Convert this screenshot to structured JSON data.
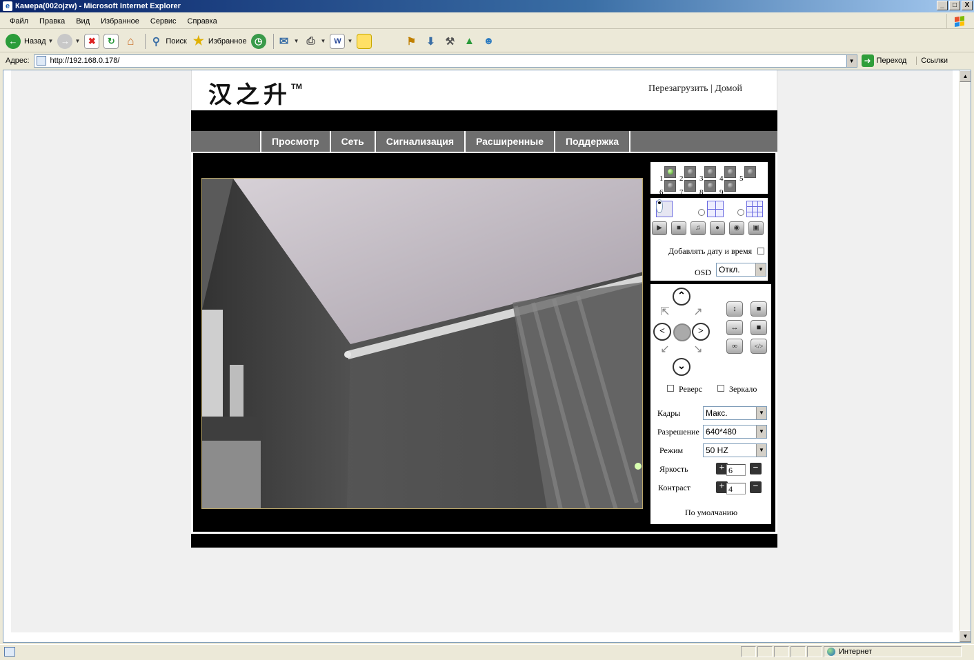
{
  "window": {
    "title": "Камера(002ojzw) - Microsoft Internet Explorer",
    "controls": [
      "_",
      "□",
      "X"
    ]
  },
  "menu": [
    "Файл",
    "Правка",
    "Вид",
    "Избранное",
    "Сервис",
    "Справка"
  ],
  "toolbar": {
    "back": "Назад",
    "search": "Поиск",
    "favorites": "Избранное"
  },
  "address": {
    "label": "Адрес:",
    "url": "http://192.168.0.178/",
    "go": "Переход",
    "links": "Ссылки"
  },
  "site": {
    "logo": "汉之升",
    "tm": "TM",
    "top_links": "Перезагрузить | Домой",
    "nav": [
      "Просмотр",
      "Сеть",
      "Сигнализация",
      "Расширенные",
      "Поддержка"
    ]
  },
  "cameras": [
    "1",
    "2",
    "3",
    "4",
    "5",
    "6",
    "7",
    "8",
    "9"
  ],
  "panel": {
    "add_datetime": "Добавлять дату и время",
    "osd_label": "OSD",
    "osd_value": "Откл.",
    "reverse": "Реверс",
    "mirror": "Зеркало",
    "frames_label": "Кадры",
    "frames_value": "Макс.",
    "resolution_label": "Разрешение",
    "resolution_value": "640*480",
    "mode_label": "Режим",
    "mode_value": "50 HZ",
    "brightness_label": "Яркость",
    "brightness_value": "6",
    "contrast_label": "Контраст",
    "contrast_value": "4",
    "default": "По умолчанию"
  },
  "status": {
    "zone": "Интернет"
  },
  "colors": {
    "ie_title": "#0a246a",
    "nav_bg": "#6e6e6e",
    "chrome": "#ece9d8"
  }
}
